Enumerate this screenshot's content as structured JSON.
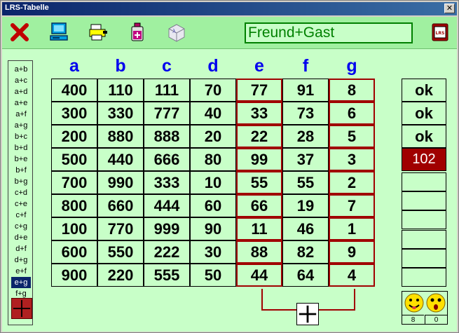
{
  "window": {
    "title": "LRS-Tabelle",
    "close_glyph": "✕"
  },
  "toolbar": {
    "icons": [
      "close-x-icon",
      "computer-icon",
      "printer-icon",
      "bottle-icon",
      "dice-icon",
      "lrs-exit-icon"
    ],
    "player_name": "Freund+Gast"
  },
  "sidebar": {
    "pairs": [
      "a+b",
      "a+c",
      "a+d",
      "a+e",
      "a+f",
      "a+g",
      "b+c",
      "b+d",
      "b+e",
      "b+f",
      "b+g",
      "c+d",
      "c+e",
      "c+f",
      "c+g",
      "d+e",
      "d+f",
      "d+g",
      "e+f",
      "e+g",
      "f+g"
    ],
    "selected": "e+g"
  },
  "table": {
    "columns": [
      "a",
      "b",
      "c",
      "d",
      "e",
      "f",
      "g"
    ],
    "rows": [
      [
        "400",
        "110",
        "111",
        "70",
        "77",
        "91",
        "8"
      ],
      [
        "300",
        "330",
        "777",
        "40",
        "33",
        "73",
        "6"
      ],
      [
        "200",
        "880",
        "888",
        "20",
        "22",
        "28",
        "5"
      ],
      [
        "500",
        "440",
        "666",
        "80",
        "99",
        "37",
        "3"
      ],
      [
        "700",
        "990",
        "333",
        "10",
        "55",
        "55",
        "2"
      ],
      [
        "800",
        "660",
        "444",
        "60",
        "66",
        "19",
        "7"
      ],
      [
        "100",
        "770",
        "999",
        "90",
        "11",
        "46",
        "1"
      ],
      [
        "600",
        "550",
        "222",
        "30",
        "88",
        "82",
        "9"
      ],
      [
        "900",
        "220",
        "555",
        "50",
        "44",
        "64",
        "4"
      ]
    ],
    "highlighted_columns": [
      "e",
      "g"
    ]
  },
  "results": [
    "ok",
    "ok",
    "ok",
    "102",
    "",
    "",
    "",
    "",
    "",
    ""
  ],
  "score": {
    "happy": "8",
    "sad": "0"
  },
  "colors": {
    "accent_red": "#a00000",
    "toolbar_green": "#a0f0a0",
    "bg_green": "#c8ffc8",
    "header_blue": "#0000ee"
  }
}
